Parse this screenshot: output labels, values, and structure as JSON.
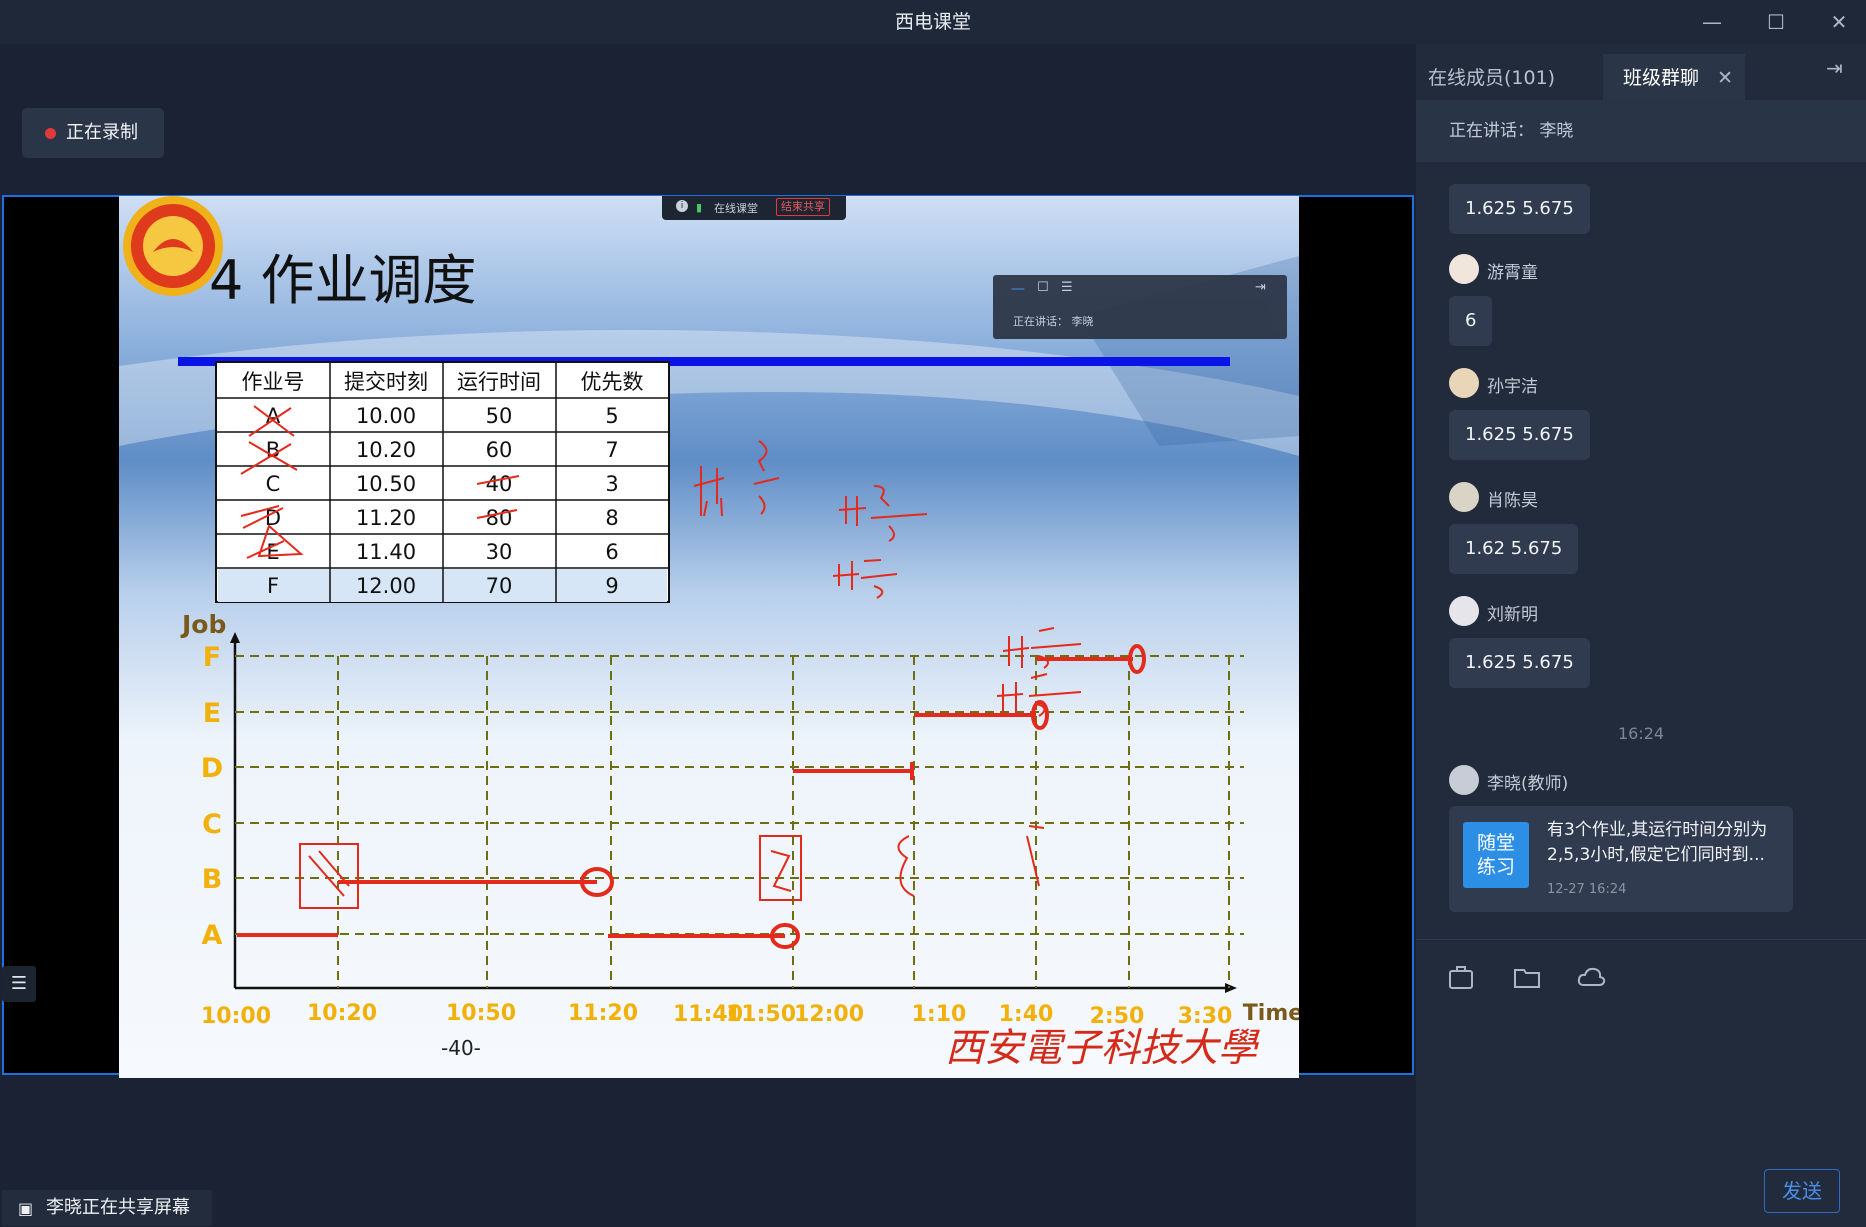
{
  "app": {
    "title": "西电课堂"
  },
  "window_controls": {
    "minimize": "—",
    "maximize": "☐",
    "close": "✕"
  },
  "recording": {
    "label": "正在录制"
  },
  "share_bar": {
    "app_label": "在线课堂",
    "stop_label": "结束共享"
  },
  "mini_window": {
    "speaking": "正在讲话： 李晓"
  },
  "slide": {
    "title": "4 作业调度",
    "page": "-40-",
    "university_text": "西安電子科技大學",
    "table": {
      "headers": [
        "作业号",
        "提交时刻",
        "运行时间",
        "优先数"
      ],
      "rows": [
        [
          "A",
          "10.00",
          "50",
          "5"
        ],
        [
          "B",
          "10.20",
          "60",
          "7"
        ],
        [
          "C",
          "10.50",
          "40",
          "3"
        ],
        [
          "D",
          "11.20",
          "80",
          "8"
        ],
        [
          "E",
          "11.40",
          "30",
          "6"
        ],
        [
          "F",
          "12.00",
          "70",
          "9"
        ]
      ]
    },
    "gantt": {
      "y_title": "Job",
      "x_title": "Time",
      "jobs": [
        "F",
        "E",
        "D",
        "C",
        "B",
        "A"
      ],
      "x_ticks": [
        "10:00",
        "10:20",
        "10:50",
        "11:20",
        "11:40",
        "11:50",
        "12:00",
        "1:10",
        "1:40",
        "2:50",
        "3:30"
      ]
    },
    "colors": {
      "accent_blue": "#0a14e6",
      "gantt_label": "#f2b00a",
      "ink": "#e42a1c",
      "grid": "#6d6d12"
    }
  },
  "panel": {
    "tabs": [
      {
        "label": "在线成员(101)",
        "active": false
      },
      {
        "label": "班级群聊",
        "active": true
      }
    ],
    "speaking": "正在讲话：  李晓",
    "messages": [
      {
        "name": "",
        "text": "1.625 5.675"
      },
      {
        "name": "游霄童",
        "text": "6"
      },
      {
        "name": "孙宇洁",
        "text": "1.625 5.675"
      },
      {
        "name": "肖陈昊",
        "text": "1.62 5.675"
      },
      {
        "name": "刘新明",
        "text": "1.625 5.675"
      }
    ],
    "timestamp": "16:24",
    "teacher": {
      "name": "李晓(教师)",
      "card_badge": "随堂\n练习",
      "card_text": "有3个作业,其运行时间分别为2,5,3小时,假定它们同时到...",
      "card_time": "12-27 16:24"
    },
    "send_label": "发送"
  },
  "footer": {
    "sharing_label": "李晓正在共享屏幕"
  }
}
